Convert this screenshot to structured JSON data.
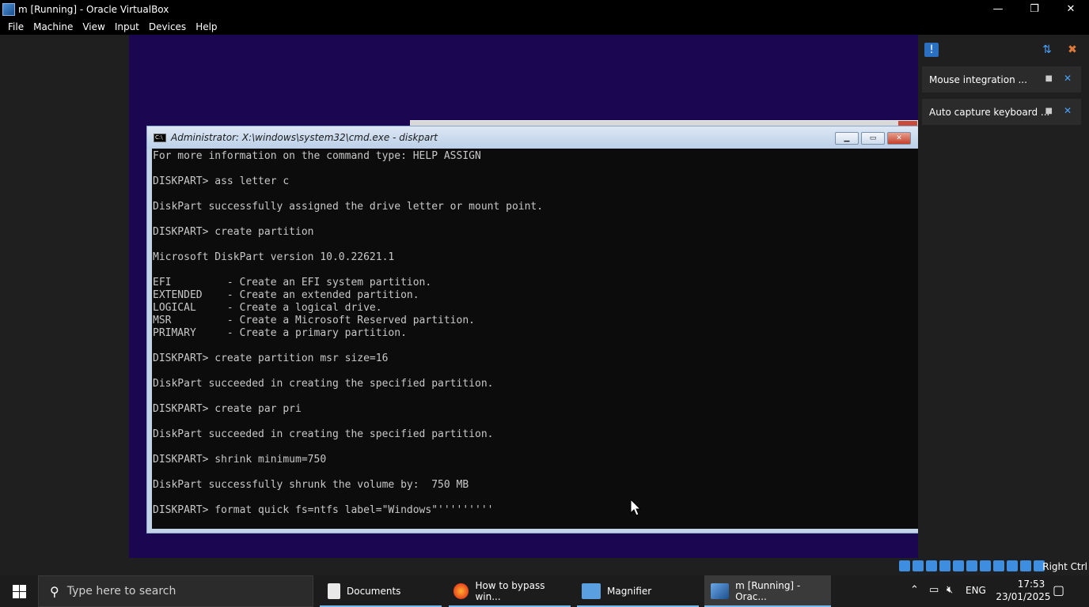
{
  "window": {
    "title": "m [Running] - Oracle VirtualBox",
    "minimize": "—",
    "restore": "❐",
    "close": "✕"
  },
  "menu": [
    "File",
    "Machine",
    "View",
    "Input",
    "Devices",
    "Help"
  ],
  "cmd": {
    "title": "Administrator: X:\\windows\\system32\\cmd.exe - diskpart",
    "icon_text": "C:\\",
    "lines": [
      "For more information on the command type: HELP ASSIGN",
      "",
      "DISKPART> ass letter c",
      "",
      "DiskPart successfully assigned the drive letter or mount point.",
      "",
      "DISKPART> create partition",
      "",
      "Microsoft DiskPart version 10.0.22621.1",
      "",
      "EFI         - Create an EFI system partition.",
      "EXTENDED    - Create an extended partition.",
      "LOGICAL     - Create a logical drive.",
      "MSR         - Create a Microsoft Reserved partition.",
      "PRIMARY     - Create a primary partition.",
      "",
      "DISKPART> create partition msr size=16",
      "",
      "DiskPart succeeded in creating the specified partition.",
      "",
      "DISKPART> create par pri",
      "",
      "DiskPart succeeded in creating the specified partition.",
      "",
      "DISKPART> shrink minimum=750",
      "",
      "DiskPart successfully shrunk the volume by:  750 MB",
      "",
      "DISKPART> format quick fs=ntfs label=\"Windows\"'''''''''"
    ]
  },
  "notifications": [
    {
      "text": "Mouse integration ..."
    },
    {
      "text": "Auto capture keyboard ..."
    }
  ],
  "statusbar": {
    "host_key": "Right Ctrl"
  },
  "taskbar": {
    "search_placeholder": "Type here to search",
    "items": [
      {
        "label": "Documents",
        "icon_color": "#e8e8e8"
      },
      {
        "label": "How to bypass win...",
        "icon_color": "#ff7a1a"
      },
      {
        "label": "Magnifier",
        "icon_color": "#5aa0e0"
      },
      {
        "label": "m [Running] - Orac...",
        "icon_color": "#3f7fd0"
      }
    ],
    "lang": "ENG",
    "time": "17:53",
    "date": "23/01/2025"
  }
}
